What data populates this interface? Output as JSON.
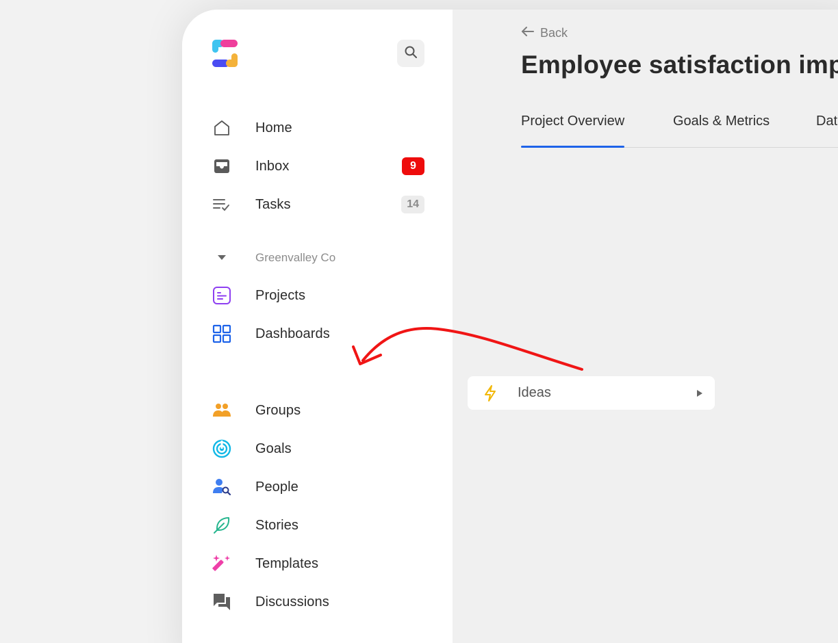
{
  "sidebar": {
    "top_nav": [
      {
        "label": "Home",
        "icon": "home-icon",
        "badge": null
      },
      {
        "label": "Inbox",
        "icon": "inbox-icon",
        "badge": "9",
        "badge_style": "red"
      },
      {
        "label": "Tasks",
        "icon": "tasks-icon",
        "badge": "14",
        "badge_style": "gray"
      }
    ],
    "workspace": {
      "name": "Greenvalley Co",
      "icon": "caret-down-icon",
      "items": [
        {
          "label": "Projects",
          "icon": "projects-icon",
          "color": "#8e3ff1"
        },
        {
          "label": "Dashboards",
          "icon": "dashboards-icon",
          "color": "#1e63e9"
        }
      ]
    },
    "bottom_nav": [
      {
        "label": "Groups",
        "icon": "groups-icon",
        "color": "#f2a027"
      },
      {
        "label": "Goals",
        "icon": "goals-icon",
        "color": "#12b8e6"
      },
      {
        "label": "People",
        "icon": "people-icon",
        "color": "#3f7ef0"
      },
      {
        "label": "Stories",
        "icon": "stories-icon",
        "color": "#27b68f"
      },
      {
        "label": "Templates",
        "icon": "templates-icon",
        "color": "#ee3fa8"
      },
      {
        "label": "Discussions",
        "icon": "discussions-icon",
        "color": "#6b6b6b"
      }
    ]
  },
  "header": {
    "back_label": "Back",
    "title": "Employee satisfaction imp"
  },
  "tabs": [
    {
      "label": "Project Overview",
      "active": true
    },
    {
      "label": "Goals & Metrics",
      "active": false
    },
    {
      "label": "Dat",
      "active": false
    }
  ],
  "ideas_card": {
    "label": "Ideas",
    "icon": "lightning-icon",
    "icon_color": "#f2b705"
  },
  "colors": {
    "accent": "#1e63e9",
    "badge_red": "#ee0c0c",
    "annotation_arrow": "#f01515"
  }
}
